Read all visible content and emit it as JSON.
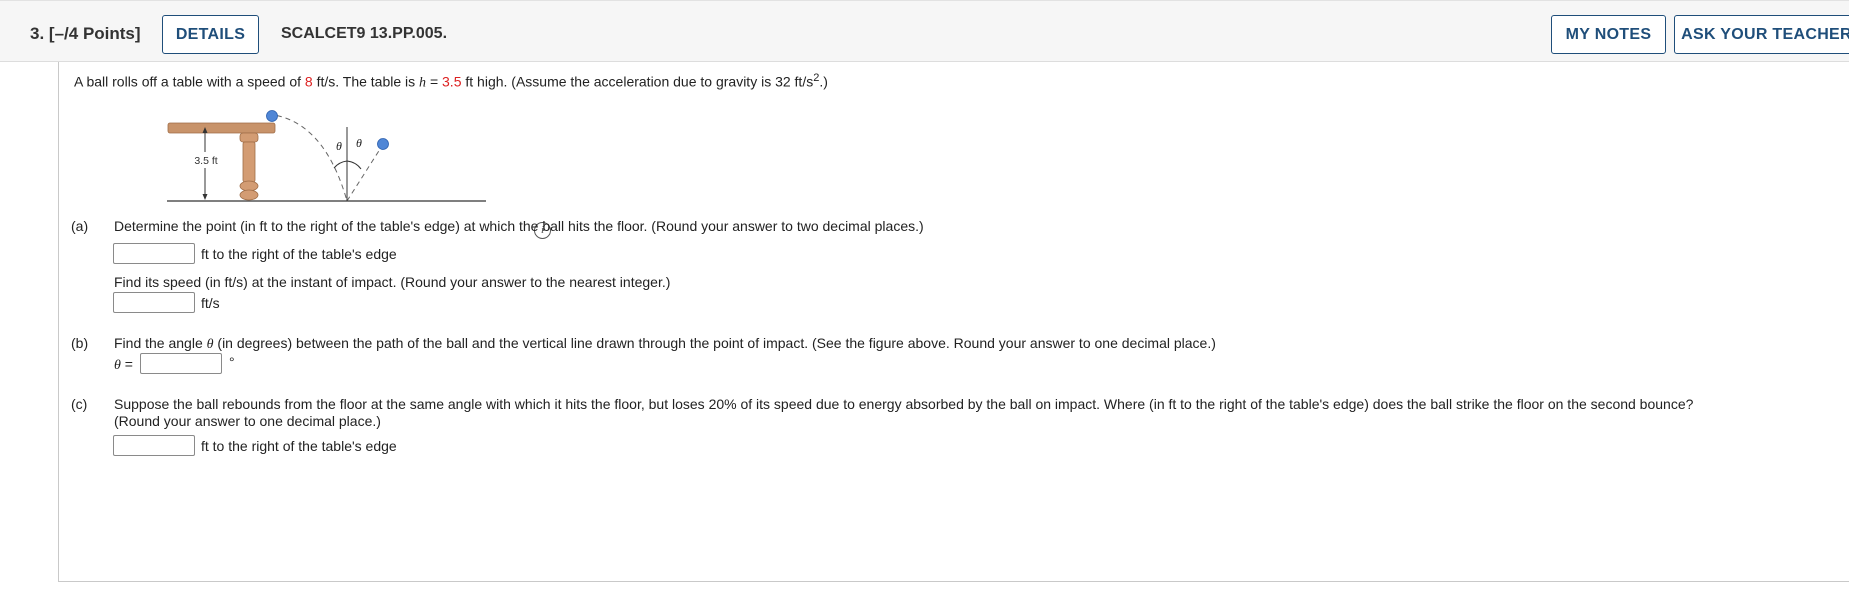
{
  "header": {
    "question_number": "3.",
    "points": "[–/4 Points]",
    "details_label": "DETAILS",
    "code": "SCALCET9 13.PP.005.",
    "my_notes_label": "MY NOTES",
    "ask_teacher_label": "ASK YOUR TEACHER"
  },
  "problem": {
    "intro_1": "A ball rolls off a table with a speed of",
    "speed": "8",
    "intro_2": "ft/s. The table is",
    "h_var": "h",
    "intro_eq": "=",
    "height": "3.5",
    "intro_3": "ft high. (Assume the acceleration due to gravity is 32 ft/s",
    "intro_sup": "2",
    "intro_4": ".)"
  },
  "figure": {
    "height_label": "3.5 ft",
    "theta_left": "θ",
    "theta_right": "θ",
    "colors": {
      "table": "#c8936a",
      "ball": "#4f86d6"
    }
  },
  "info_icon": "i",
  "part_a": {
    "tag": "(a)",
    "question": "Determine the point (in ft to the right of the table's edge) at which the ball hits the floor. (Round your answer to two decimal places.)",
    "answer_value": "",
    "unit": "ft to the right of the table's edge",
    "question2": "Find its speed (in ft/s) at the instant of impact. (Round your answer to the nearest integer.)",
    "answer2_value": "",
    "unit2": "ft/s"
  },
  "part_b": {
    "tag": "(b)",
    "question_1": "Find the angle",
    "theta": "θ",
    "question_2": "(in degrees) between the path of the ball and the vertical line drawn through the point of impact. (See the figure above. Round your answer to one decimal place.)",
    "eq_label": "θ",
    "eq_sign": "=",
    "answer_value": "",
    "unit": "°"
  },
  "part_c": {
    "tag": "(c)",
    "question_line1": "Suppose the ball rebounds from the floor at the same angle with which it hits the floor, but loses 20% of its speed due to energy absorbed by the ball on impact. Where (in ft to the right of the table's edge) does the ball strike the floor on the second bounce?",
    "question_line2": "(Round your answer to one decimal place.)",
    "answer_value": "",
    "unit": "ft to the right of the table's edge"
  }
}
